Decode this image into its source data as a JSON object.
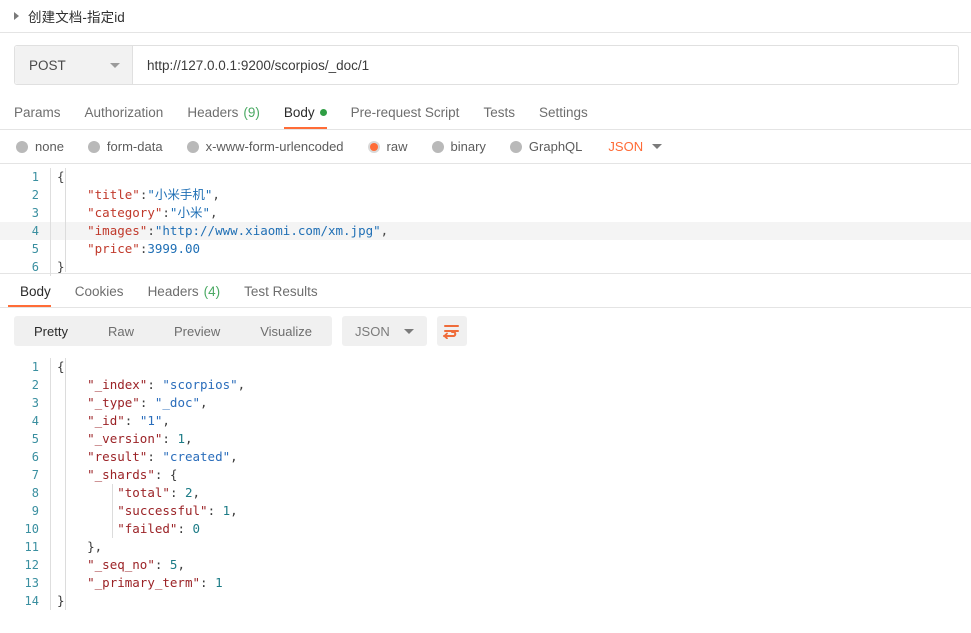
{
  "breadcrumb": {
    "icon": "triangle-right-icon",
    "title": "创建文档-指定id"
  },
  "request": {
    "method": "POST",
    "method_caret_icon": "chevron-down-icon",
    "url": "http://127.0.0.1:9200/scorpios/_doc/1",
    "url_placeholder": "Enter request URL",
    "tabs": [
      {
        "label": "Params",
        "active": false
      },
      {
        "label": "Authorization",
        "active": false
      },
      {
        "label": "Headers",
        "count": "(9)",
        "active": false
      },
      {
        "label": "Body",
        "active": true,
        "dot": true
      },
      {
        "label": "Pre-request Script",
        "active": false
      },
      {
        "label": "Tests",
        "active": false
      },
      {
        "label": "Settings",
        "active": false
      }
    ],
    "body_types": [
      {
        "label": "none",
        "selected": false
      },
      {
        "label": "form-data",
        "selected": false
      },
      {
        "label": "x-www-form-urlencoded",
        "selected": false
      },
      {
        "label": "raw",
        "selected": true
      },
      {
        "label": "binary",
        "selected": false
      },
      {
        "label": "GraphQL",
        "selected": false
      }
    ],
    "format": "JSON",
    "format_caret_icon": "chevron-down-icon",
    "body_lines": [
      {
        "n": "1",
        "text": "{"
      },
      {
        "n": "2",
        "text": "    \"title\":\"小米手机\","
      },
      {
        "n": "3",
        "text": "    \"category\":\"小米\","
      },
      {
        "n": "4",
        "text": "    \"images\":\"http://www.xiaomi.com/xm.jpg\","
      },
      {
        "n": "5",
        "text": "    \"price\":3999.00"
      },
      {
        "n": "6",
        "text": "}"
      }
    ]
  },
  "response": {
    "tabs": [
      {
        "label": "Body",
        "active": true
      },
      {
        "label": "Cookies",
        "active": false
      },
      {
        "label": "Headers",
        "count": "(4)",
        "active": false
      },
      {
        "label": "Test Results",
        "active": false
      }
    ],
    "viewers": [
      {
        "label": "Pretty",
        "active": true
      },
      {
        "label": "Raw",
        "active": false
      },
      {
        "label": "Preview",
        "active": false
      },
      {
        "label": "Visualize",
        "active": false
      }
    ],
    "format": "JSON",
    "format_caret_icon": "chevron-down-icon",
    "wrap_icon": "word-wrap-icon",
    "body_lines": [
      {
        "n": "1",
        "text": "{"
      },
      {
        "n": "2",
        "text": "    \"_index\": \"scorpios\","
      },
      {
        "n": "3",
        "text": "    \"_type\": \"_doc\","
      },
      {
        "n": "4",
        "text": "    \"_id\": \"1\","
      },
      {
        "n": "5",
        "text": "    \"_version\": 1,"
      },
      {
        "n": "6",
        "text": "    \"result\": \"created\","
      },
      {
        "n": "7",
        "text": "    \"_shards\": {"
      },
      {
        "n": "8",
        "text": "        \"total\": 2,"
      },
      {
        "n": "9",
        "text": "        \"successful\": 1,"
      },
      {
        "n": "10",
        "text": "        \"failed\": 0"
      },
      {
        "n": "11",
        "text": "    },"
      },
      {
        "n": "12",
        "text": "    \"_seq_no\": 5,"
      },
      {
        "n": "13",
        "text": "    \"_primary_term\": 1"
      },
      {
        "n": "14",
        "text": "}"
      }
    ]
  },
  "colors": {
    "accent": "#ff6c37",
    "green": "#2f9e44",
    "count_green": "#4aa963",
    "gutter": "#3a8fa0"
  }
}
